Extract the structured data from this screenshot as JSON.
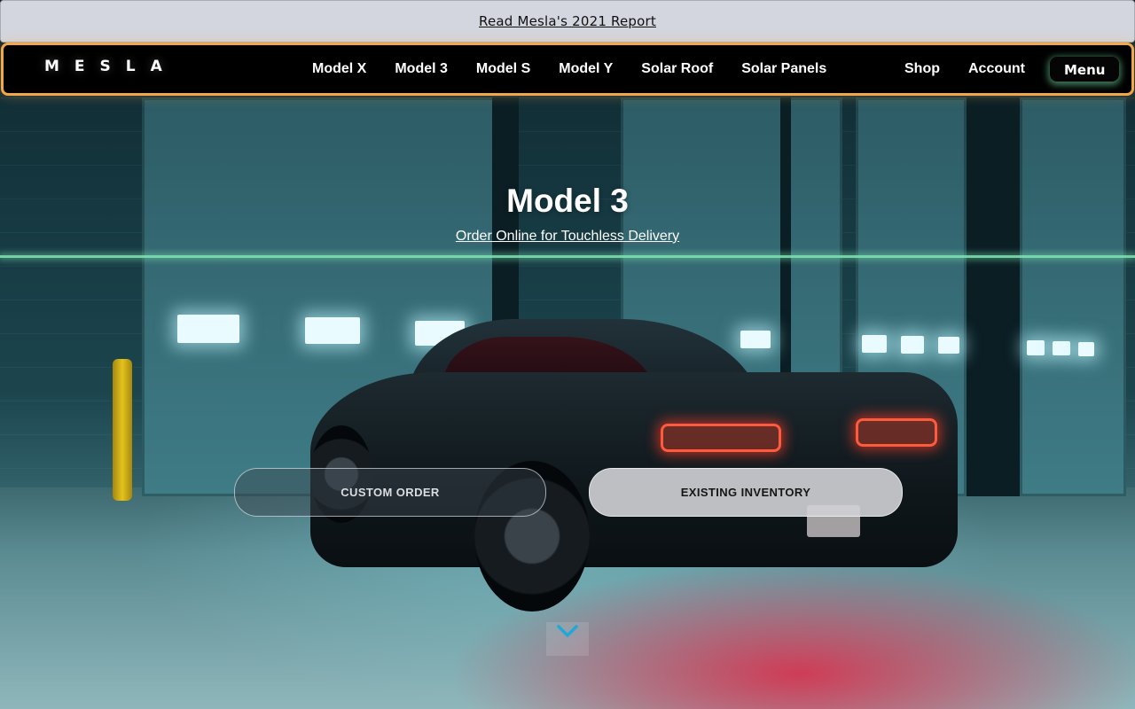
{
  "report_bar": {
    "link_text": "Read Mesla's 2021 Report"
  },
  "nav": {
    "logo": "MESLA",
    "links": [
      "Model X",
      "Model 3",
      "Model S",
      "Model Y",
      "Solar Roof",
      "Solar Panels"
    ],
    "right_links": [
      "Shop",
      "Account"
    ],
    "menu_label": "Menu"
  },
  "hero": {
    "title": "Model 3",
    "subtitle_link": "Order Online for Touchless Delivery",
    "buttons": {
      "custom_order": "CUSTOM ORDER",
      "existing_inventory": "EXISTING INVENTORY"
    },
    "scroll_icon": "chevron-down-icon"
  },
  "colors": {
    "nav_border": "#f2a84a",
    "menu_glow": "#78e6aa",
    "divider": "#7de2b1",
    "chevron": "#1fa8d8"
  }
}
